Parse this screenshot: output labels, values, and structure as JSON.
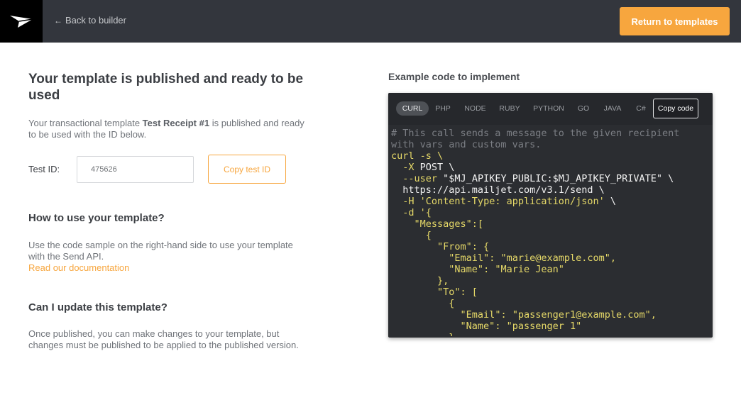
{
  "topbar": {
    "back_label": "Back to builder",
    "return_label": "Return to templates"
  },
  "left": {
    "title": "Your template is published and ready to be used",
    "desc_prefix": "Your transactional template ",
    "template_name": "Test Receipt #1",
    "desc_suffix": " is published and ready to be used with the ID below.",
    "test_id_label": "Test ID:",
    "test_id_value": "475626",
    "copy_test_label": "Copy test ID",
    "howto_title": "How to use your template?",
    "howto_text": "Use the code sample on the right-hand side to use your template with the Send API.",
    "doc_link": "Read our documentation",
    "update_title": "Can I update this template?",
    "update_text": "Once published, you can make changes to your template, but changes must be published to be applied to the published version."
  },
  "right": {
    "title": "Example code to implement",
    "tabs": [
      "CURL",
      "PHP",
      "NODE",
      "RUBY",
      "PYTHON",
      "GO",
      "JAVA",
      "C#"
    ],
    "active_tab": "CURL",
    "copy_code_label": "Copy code",
    "code": {
      "comment1": "# This call sends a message to the given recipient",
      "comment2": "with vars and custom vars.",
      "l_curl": "curl -s \\",
      "l_x_flag": "-X",
      "l_x_val": " POST \\",
      "l_user_flag": "--user",
      "l_user_val": " \"$MJ_APIKEY_PUBLIC:$MJ_APIKEY_PRIVATE\" \\",
      "l_url": "https://api.mailjet.com/v3.1/send \\",
      "l_h_flag": "-H",
      "l_h_val": " 'Content-Type: application/json'",
      "l_h_tail": " \\",
      "l_d": "-d '{",
      "l_messages": "\"Messages\":[",
      "l_open1": "{",
      "l_from": "\"From\": {",
      "l_email_key": "\"Email\"",
      "l_email_val": ": \"marie@example.com\",",
      "l_name_key": "\"Name\"",
      "l_name_val": ": \"Marie Jean\"",
      "l_close_from": "},",
      "l_to": "\"To\": [",
      "l_open2": "{",
      "l_to_email_key": "\"Email\"",
      "l_to_email_val": ": \"passenger1@example.com\",",
      "l_to_name_key": "\"Name\"",
      "l_to_name_val": ": \"passenger 1\"",
      "l_close_to": "}"
    }
  }
}
